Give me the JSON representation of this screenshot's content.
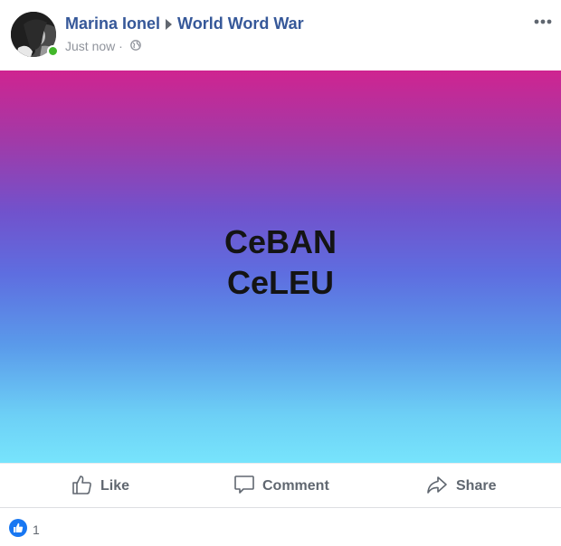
{
  "post": {
    "author": "Marina Ionel",
    "group": "World Word War",
    "time": "Just now",
    "content_lines": [
      "CeBAN",
      "CeLEU"
    ],
    "actions": {
      "like": "Like",
      "comment": "Comment",
      "share": "Share"
    },
    "reaction_count": "1"
  },
  "icons": {
    "more": "more-options-icon",
    "privacy": "globe-icon",
    "like": "thumbs-up-icon",
    "comment": "comment-bubble-icon",
    "share": "share-arrow-icon",
    "reaction": "like-reaction-icon"
  },
  "colors": {
    "link": "#365899",
    "secondary_text": "#90949c",
    "action_text": "#606770",
    "online": "#42b72a",
    "reaction_blue": "#1877f2"
  }
}
